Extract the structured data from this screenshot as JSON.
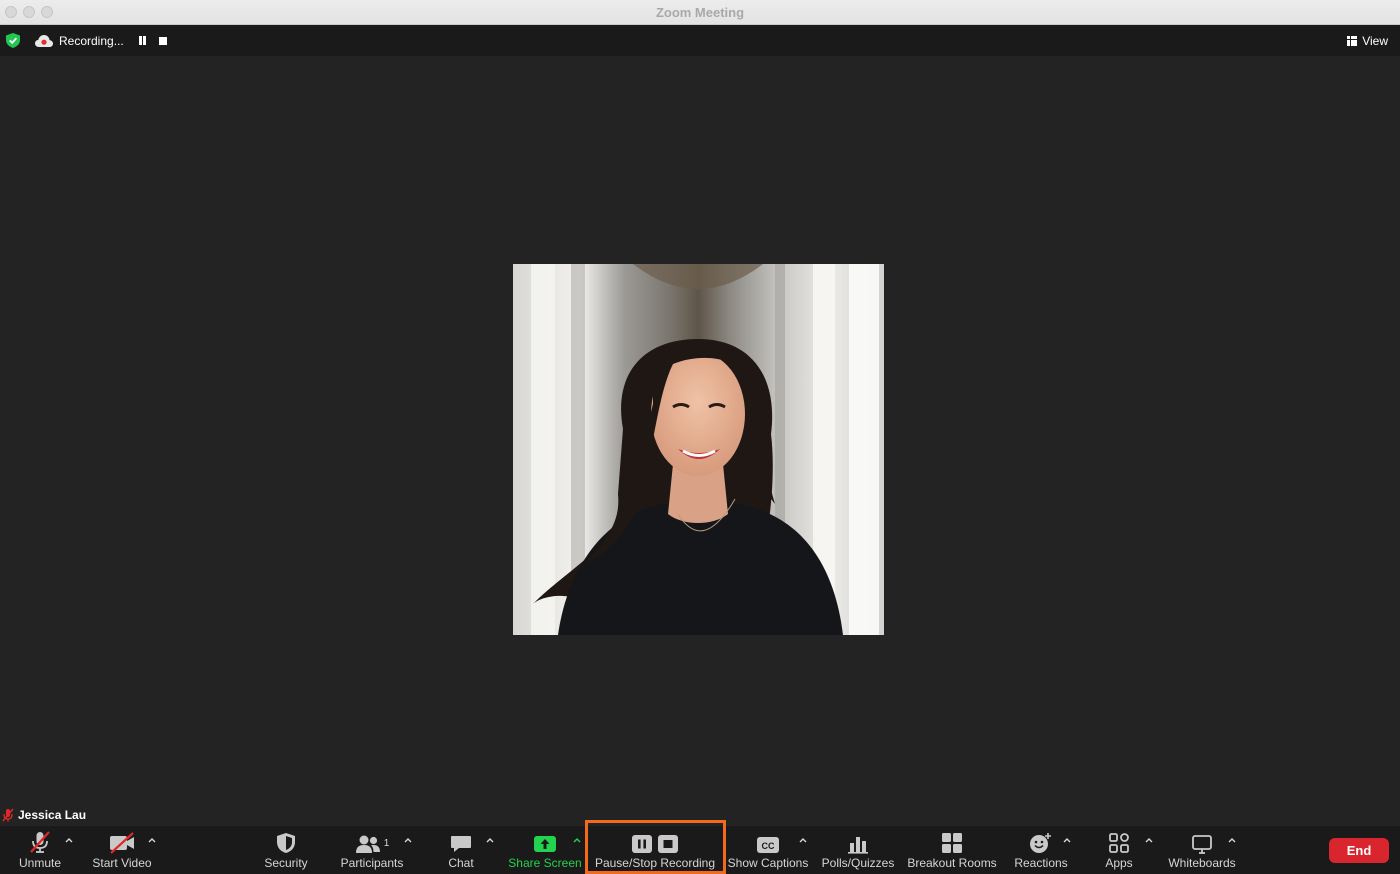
{
  "window": {
    "title": "Zoom Meeting"
  },
  "topbar": {
    "recording_label": "Recording...",
    "view_label": "View"
  },
  "participant": {
    "name": "Jessica Lau"
  },
  "toolbar": {
    "unmute": "Unmute",
    "start_video": "Start Video",
    "security": "Security",
    "participants": "Participants",
    "participants_count": "1",
    "chat": "Chat",
    "share_screen": "Share Screen",
    "pause_stop_recording": "Pause/Stop Recording",
    "show_captions": "Show Captions",
    "polls": "Polls/Quizzes",
    "breakout_rooms": "Breakout Rooms",
    "reactions": "Reactions",
    "apps": "Apps",
    "whiteboards": "Whiteboards",
    "end": "End",
    "captions_icon_text": "CC"
  },
  "colors": {
    "stage_bg": "#232323",
    "toolbar_bg": "#1a1a1a",
    "share_green": "#23d24e",
    "end_red": "#d9262e",
    "highlight_orange": "#f26a1b",
    "shield_green": "#23c552"
  },
  "icons": {
    "security": "shield-icon",
    "recording": "cloud-record-icon",
    "mic": "mic-muted-icon",
    "video": "video-off-icon"
  }
}
